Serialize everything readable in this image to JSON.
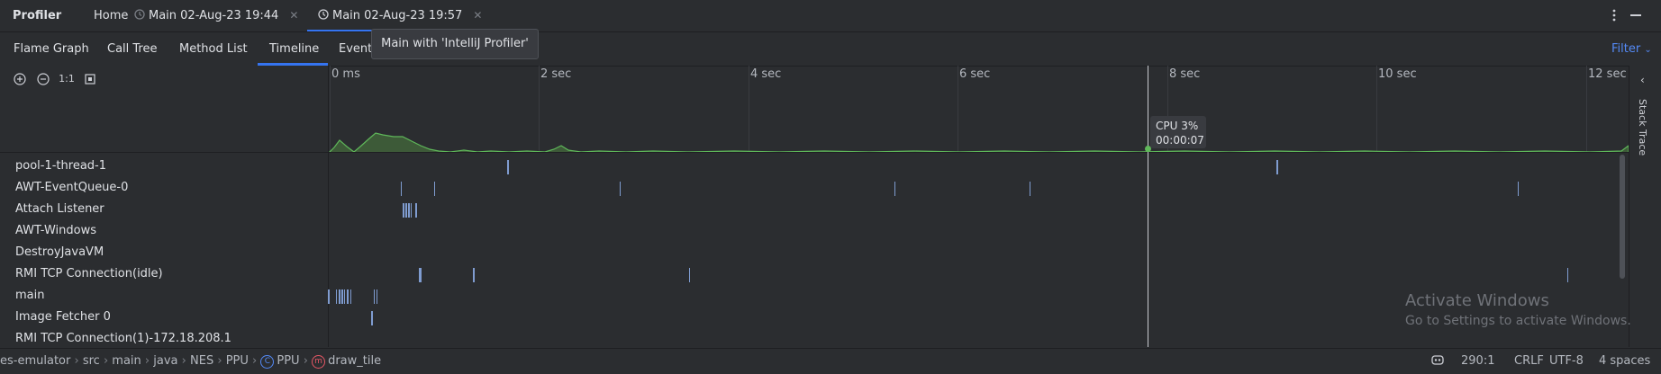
{
  "titlebar": {
    "app_title": "Profiler",
    "tabs": [
      {
        "label": "Home"
      },
      {
        "label": "Main 02-Aug-23 19:44"
      },
      {
        "label": "Main 02-Aug-23 19:57"
      }
    ],
    "more_icon": "kebab-icon",
    "minimize_icon": "minimize-icon"
  },
  "tooltip": {
    "text": "Main with 'IntelliJ Profiler'"
  },
  "subtabs": {
    "items": [
      "Flame Graph",
      "Call Tree",
      "Method List",
      "Timeline",
      "Event"
    ],
    "active": "Timeline",
    "filter_label": "Filter"
  },
  "timeline": {
    "zoom_reset_label": "1:1",
    "ticks": [
      "0 ms",
      "2 sec",
      "4 sec",
      "6 sec",
      "8 sec",
      "10 sec",
      "12 sec"
    ],
    "cpu_tooltip": {
      "line1": "CPU 3%",
      "line2": "00:00:07"
    },
    "threads": [
      "pool-1-thread-1",
      "AWT-EventQueue-0",
      "Attach Listener",
      "AWT-Windows",
      "DestroyJavaVM",
      "RMI TCP Connection(idle)",
      "main",
      "Image Fetcher 0",
      "RMI TCP Connection(1)-172.18.208.1"
    ],
    "side_panel_label": "Stack Trace",
    "colors": {
      "cpu_line": "#5fb85a",
      "cpu_fill": "#3d5a38",
      "event": "#7f9cd0",
      "accent": "#3574f0"
    }
  },
  "watermark": {
    "title": "Activate Windows",
    "subtitle": "Go to Settings to activate Windows."
  },
  "statusbar": {
    "breadcrumbs": [
      "es-emulator",
      "src",
      "main",
      "java",
      "NES",
      "PPU",
      "PPU",
      "draw_tile"
    ],
    "position": "290:1",
    "line_endings": "CRLF",
    "encoding": "UTF-8",
    "indent": "4 spaces"
  }
}
